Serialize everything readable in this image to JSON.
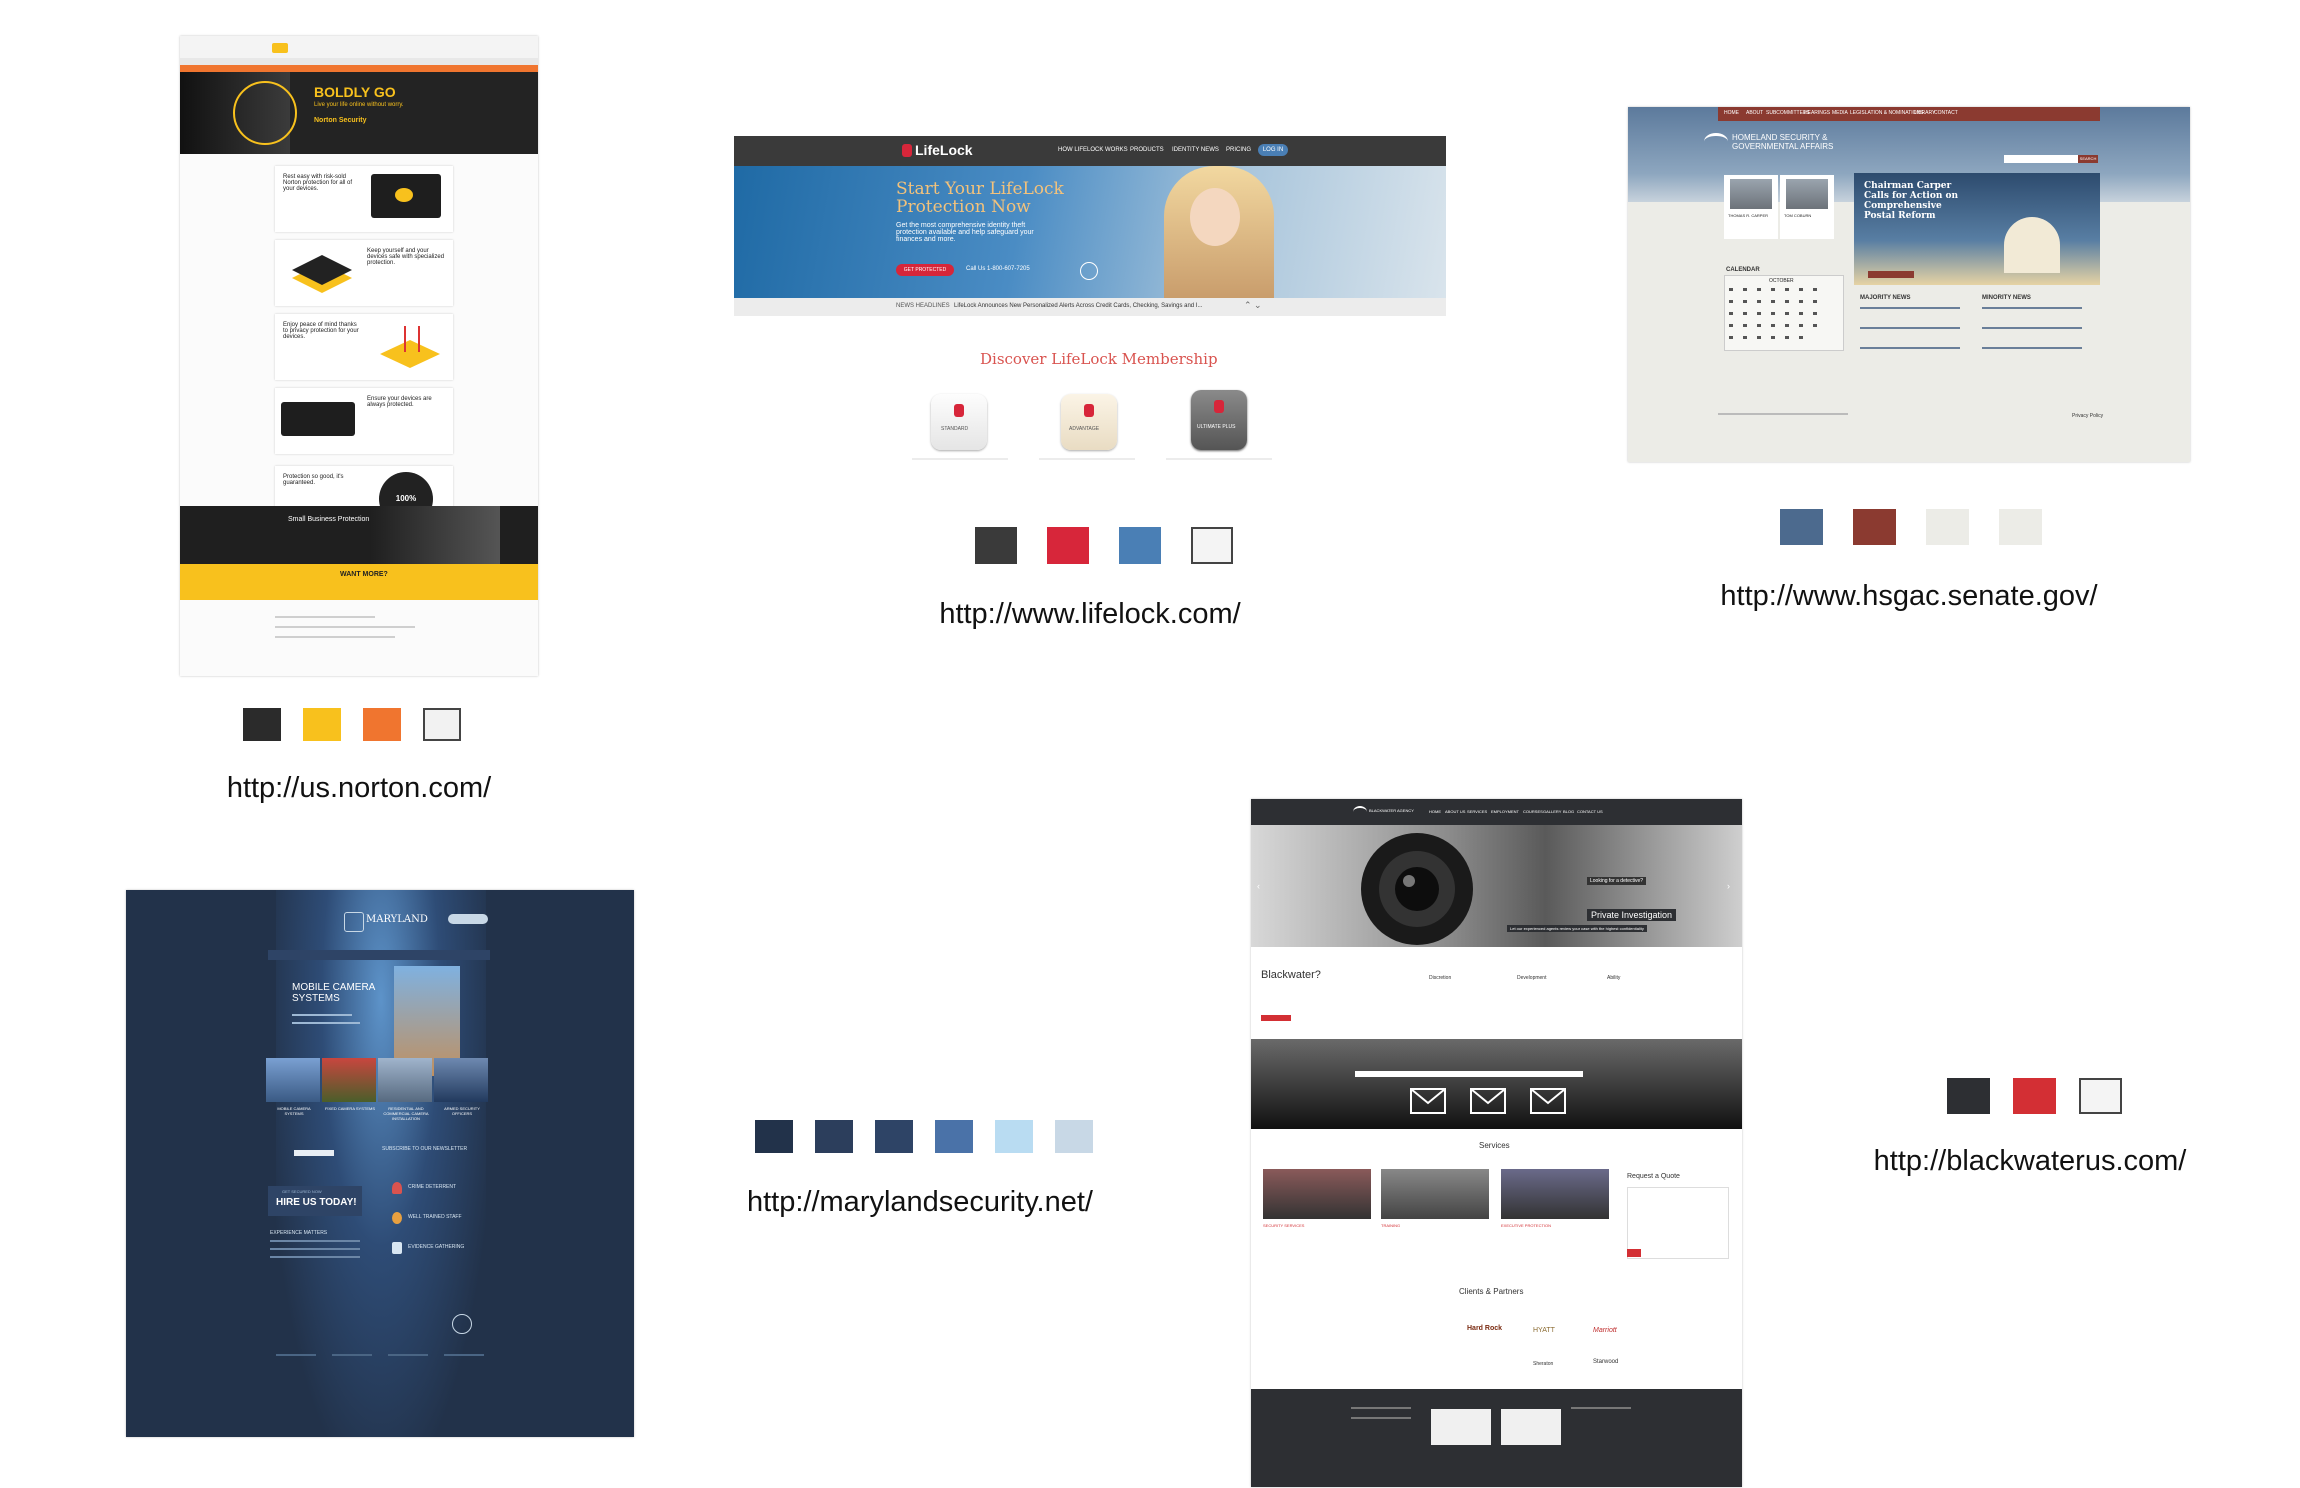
{
  "sites": [
    {
      "id": "norton",
      "url": "http://us.norton.com/",
      "swatches": [
        "#2b2b2b",
        "#f8c11d",
        "#f0752f",
        "#f2f2f2"
      ],
      "hero_title": "BOLDLY GO",
      "hero_sub": "Live your life online without worry.",
      "product": "Norton Security",
      "features": [
        "Rest easy with risk-sold Norton protection for all of your devices.",
        "Keep yourself and your devices safe with specialized protection.",
        "Enjoy peace of mind thanks to privacy protection for your devices.",
        "Ensure your devices are always protected.",
        "Protection so good, it's guaranteed."
      ],
      "badge": "100%",
      "small_business": "Small Business Protection",
      "want_more": "WANT MORE?"
    },
    {
      "id": "lifelock",
      "url": "http://www.lifelock.com/",
      "swatches": [
        "#3a3a3a",
        "#d7263a",
        "#4a7fb5",
        "#f4f4f4"
      ],
      "logo": "LifeLock",
      "nav": [
        "HOW LIFELOCK WORKS",
        "PRODUCTS",
        "IDENTITY NEWS",
        "PRICING"
      ],
      "login": "LOG IN",
      "hero_title": "Start Your LifeLock Protection Now",
      "hero_body": "Get the most comprehensive identity theft protection available and help safeguard your finances and more.",
      "cta": "GET PROTECTED",
      "phone": "Call Us 1-800-607-7205",
      "news_label": "NEWS HEADLINES",
      "news_text": "LifeLock Announces New Personalized Alerts Across Credit Cards, Checking, Savings and I...",
      "membership_title": "Discover LifeLock Membership",
      "plans": [
        "STANDARD",
        "ADVANTAGE",
        "ULTIMATE PLUS"
      ]
    },
    {
      "id": "hsgac",
      "url": "http://www.hsgac.senate.gov/",
      "swatches": [
        "#4c6a8e",
        "#8b3a30",
        "#ecece7",
        "#ecece7"
      ],
      "nav": [
        "HOME",
        "ABOUT",
        "SUBCOMMITTEES",
        "HEARINGS",
        "MEDIA",
        "LEGISLATION & NOMINATIONS",
        "LIBRARY",
        "CONTACT"
      ],
      "committee": "HOMELAND SECURITY & GOVERNMENTAL AFFAIRS",
      "search": "SEARCH",
      "members": [
        "THOMAS R. CARPER",
        "TOM COBURN"
      ],
      "headline": "Chairman Carper Calls for Action on Comprehensive Postal Reform",
      "calendar": "CALENDAR",
      "month": "OCTOBER",
      "majority": "MAJORITY NEWS",
      "minority": "MINORITY NEWS",
      "privacy": "Privacy Policy"
    },
    {
      "id": "maryland",
      "url": "http://marylandsecurity.net/",
      "swatches": [
        "#22324a",
        "#2c3e5c",
        "#2e4466",
        "#4a72a8",
        "#b9dcf2",
        "#c8d8e6"
      ],
      "logo": "MARYLAND",
      "hero_title": "MOBILE CAMERA SYSTEMS",
      "tiles": [
        "MOBILE CAMERA SYSTEMS",
        "FIXED CAMERA SYSTEMS",
        "RESIDENTIAL AND COMMERCIAL CAMERA INSTALLATION",
        "ARMED SECURITY OFFICERS"
      ],
      "newsletter": "SUBSCRIBE TO OUR NEWSLETTER",
      "hire_small": "GET SECURED NOW",
      "hire": "HIRE US TODAY!",
      "experience": "EXPERIENCE MATTERS",
      "services": [
        "CRIME DETERRENT",
        "WELL TRAINED STAFF",
        "EVIDENCE GATHERING"
      ]
    },
    {
      "id": "blackwater",
      "url": "http://blackwaterus.com/",
      "swatches": [
        "#2d2f33",
        "#d32f34",
        "#f4f4f4"
      ],
      "logo": "BLACKWATER AGENCY",
      "nav": [
        "HOME",
        "ABOUT US",
        "SERVICES",
        "EMPLOYMENT",
        "COURSES",
        "GALLERY",
        "BLOG",
        "CONTACT US"
      ],
      "hero_tag": "Looking for a detective?",
      "hero_title": "Private Investigation",
      "hero_sub": "Let our experienced agents review your case with the highest confidentiality",
      "why": "Blackwater?",
      "pillars": [
        "Discretion",
        "Development",
        "Ability"
      ],
      "services_title": "Services",
      "service_items": [
        "SECURITY SERVICES",
        "TRAINING",
        "EXECUTIVE PROTECTION"
      ],
      "quote": "Request a Quote",
      "clients": "Clients & Partners",
      "client_logos": [
        "Hard Rock",
        "HYATT",
        "Marriott",
        "Sheraton",
        "Starwood"
      ]
    }
  ]
}
